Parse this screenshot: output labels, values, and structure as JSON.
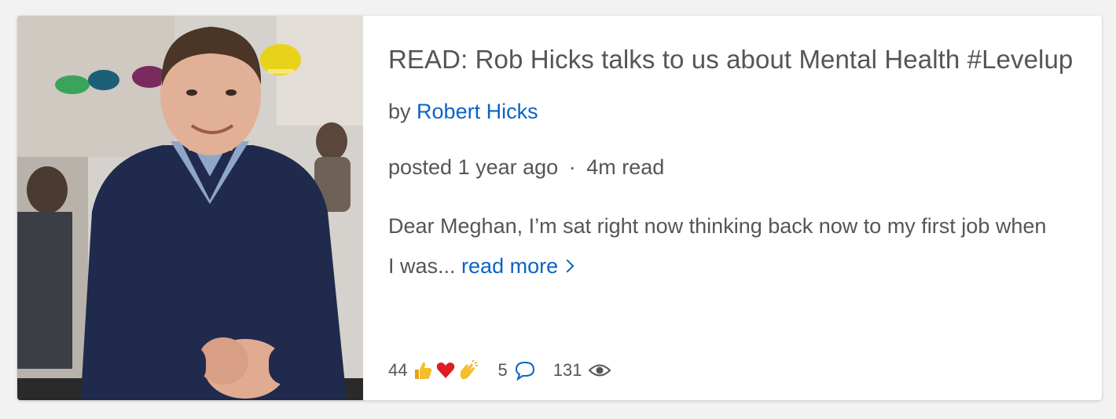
{
  "post": {
    "title": "READ: Rob Hicks talks to us about Mental Health #Levelup",
    "by_label": "by",
    "author": "Robert Hicks",
    "posted": "posted 1 year ago",
    "separator": "·",
    "read_time": "4m read",
    "excerpt": "Dear  Meghan, I’m sat right now thinking back now to my first job when I was...",
    "read_more": "read more"
  },
  "stats": {
    "reactions_count": "44",
    "reaction_icons": [
      "thumbs-up-icon",
      "heart-icon",
      "clapping-hands-icon"
    ],
    "comments_count": "5",
    "views_count": "131"
  },
  "colors": {
    "link": "#0b63c4",
    "text": "#555555",
    "background": "#f2f2f2",
    "card": "#ffffff"
  }
}
